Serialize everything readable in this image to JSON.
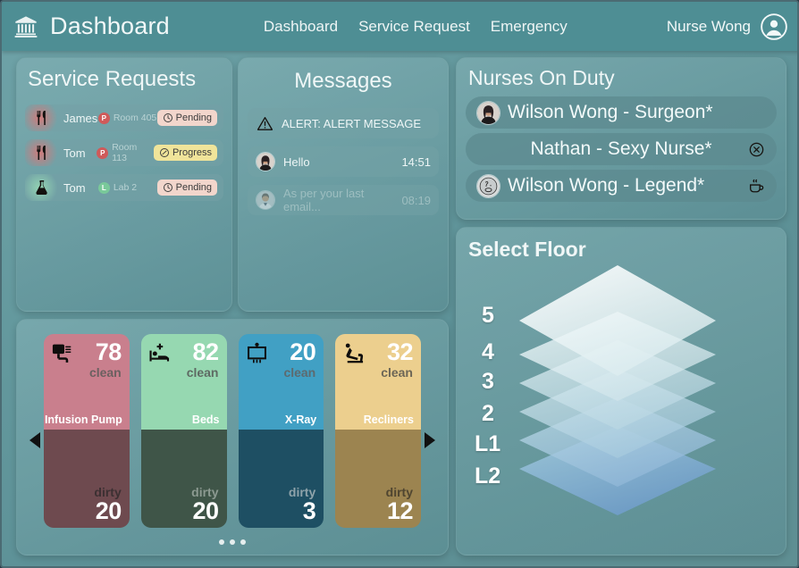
{
  "header": {
    "logo_icon": "museum-bank-icon",
    "brand": "Dashboard",
    "nav": [
      {
        "label": "Dashboard"
      },
      {
        "label": "Service Request"
      },
      {
        "label": "Emergency"
      }
    ],
    "user_name": "Nurse Wong",
    "avatar_icon": "user-circle-icon"
  },
  "service_requests": {
    "title": "Service Requests",
    "rows": [
      {
        "icon": "cutlery-icon",
        "icon_kind": "food",
        "name": "James",
        "loc_badge": "P",
        "loc_badge_kind": "p",
        "location": "Room 405",
        "status": "Pending",
        "status_kind": "pending",
        "status_icon": "clock-icon"
      },
      {
        "icon": "cutlery-icon",
        "icon_kind": "food",
        "name": "Tom",
        "loc_badge": "P",
        "loc_badge_kind": "p",
        "location": "Room 113",
        "status": "Progress",
        "status_kind": "progress",
        "status_icon": "progress-icon"
      },
      {
        "icon": "lab-flask-icon",
        "icon_kind": "lab",
        "name": "Tom",
        "loc_badge": "L",
        "loc_badge_kind": "l",
        "location": "Lab 2",
        "status": "Pending",
        "status_kind": "pending",
        "status_icon": "clock-icon"
      }
    ]
  },
  "messages": {
    "title": "Messages",
    "rows": [
      {
        "kind": "alert",
        "icon": "warning-triangle-icon",
        "text": "ALERT: ALERT MESSAGE",
        "time": ""
      },
      {
        "kind": "normal",
        "icon": "avatar-woman",
        "text": "Hello",
        "time": "14:51"
      },
      {
        "kind": "muted",
        "icon": "avatar-doctor",
        "text": "As per your last email...",
        "time": "08:19"
      }
    ]
  },
  "nurses": {
    "title": "Nurses On Duty",
    "rows": [
      {
        "avatar": "avatar-woman",
        "name": "Wilson Wong - Surgeon*",
        "action_icon": "",
        "centered": false
      },
      {
        "avatar": "",
        "name": "Nathan - Sexy Nurse*",
        "action_icon": "x-circle-icon",
        "centered": true
      },
      {
        "avatar": "avatar-face",
        "name": "Wilson Wong - Legend*",
        "action_icon": "coffee-cup-icon",
        "centered": false
      }
    ]
  },
  "floor": {
    "title": "Select Floor",
    "levels": [
      "5",
      "4",
      "3",
      "2",
      "L1",
      "L2"
    ]
  },
  "equipment": {
    "prev_label": "previous",
    "next_label": "next",
    "clean_label": "clean",
    "dirty_label": "dirty",
    "dots": 3,
    "cards": [
      {
        "icon": "infusion-pump-icon",
        "name": "Infusion Pump",
        "clean": "78",
        "dirty": "20",
        "clean_color": "#c97f8d",
        "dirty_color": "#6e4a4f",
        "clean_label_color": "#6b6060",
        "dirty_label_color": "#3c3032"
      },
      {
        "icon": "hospital-bed-icon",
        "name": "Beds",
        "clean": "82",
        "dirty": "20",
        "clean_color": "#96d8b1",
        "dirty_color": "#3f5548",
        "clean_label_color": "#5e6a63",
        "dirty_label_color": "#8c9a91"
      },
      {
        "icon": "x-ray-icon",
        "name": "X-Ray",
        "clean": "20",
        "dirty": "3",
        "clean_color": "#41a0c4",
        "dirty_color": "#1e4f63",
        "clean_label_color": "#5d6a6f",
        "dirty_label_color": "#8fa3aa"
      },
      {
        "icon": "recliner-icon",
        "name": "Recliners",
        "clean": "32",
        "dirty": "12",
        "clean_color": "#eccf8e",
        "dirty_color": "#9c8450",
        "clean_label_color": "#6c6656",
        "dirty_label_color": "#4f4530"
      }
    ]
  },
  "colors": {
    "header_bg": "#4e8e94",
    "page_bg": "#63989d",
    "panel_border": "#78a5aa",
    "text_light": "#f2f8f8"
  }
}
